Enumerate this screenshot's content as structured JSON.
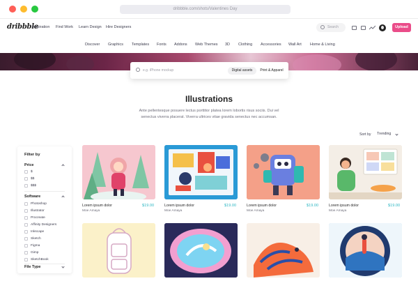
{
  "browser": {
    "url": "dribbble.com/shots/Valentines Day"
  },
  "brand": {
    "logo": "dribbble",
    "accent": "#ea4c89",
    "price_color": "#30b8c4"
  },
  "topnav": {
    "links": [
      "Inspiration",
      "Find Work",
      "Learn Design",
      "Hire Designers"
    ],
    "search_placeholder": "Search",
    "upload_label": "Upload"
  },
  "categories": [
    "Discover",
    "Graphics",
    "Templates",
    "Fonts",
    "Addons",
    "Web Themes",
    "3D",
    "Clothing",
    "Accessories",
    "Wall Art",
    "Home & Living"
  ],
  "search": {
    "placeholder": "e.g. iPhone mockup",
    "toggle_active": "Digital assets",
    "toggle_inactive": "Print & Apparel"
  },
  "heading": {
    "title": "Illustrations",
    "description": "Ante pellentesque posuere lectus porttitor platea lorem lobortis risus sociis. Dui vel senectus viverra placerat. Viverra ultrices vitae gravida senectus nec accumsan."
  },
  "sort": {
    "label": "Sort by",
    "value": "Trending"
  },
  "filters": {
    "title": "Filter by",
    "price": {
      "label": "Price",
      "options": [
        "$",
        "$$",
        "$$$"
      ]
    },
    "software": {
      "label": "Software",
      "options": [
        "Photoshop",
        "Illustrator",
        "Procreate",
        "Affinity Designers",
        "Inkscape",
        "Sketch",
        "Figma",
        "Gimp",
        "SketchBook"
      ]
    },
    "file_type": {
      "label": "File Type"
    }
  },
  "shots": [
    {
      "title": "Lorem ipsum dolor",
      "author": "Moe Amaya",
      "price": "$19.00"
    },
    {
      "title": "Lorem ipsum dolor",
      "author": "Moe Amaya",
      "price": "$19.00"
    },
    {
      "title": "Lorem ipsum dolor",
      "author": "Moe Amaya",
      "price": "$19.00"
    },
    {
      "title": "Lorem ipsum dolor",
      "author": "Moe Amaya",
      "price": "$19.00"
    }
  ]
}
